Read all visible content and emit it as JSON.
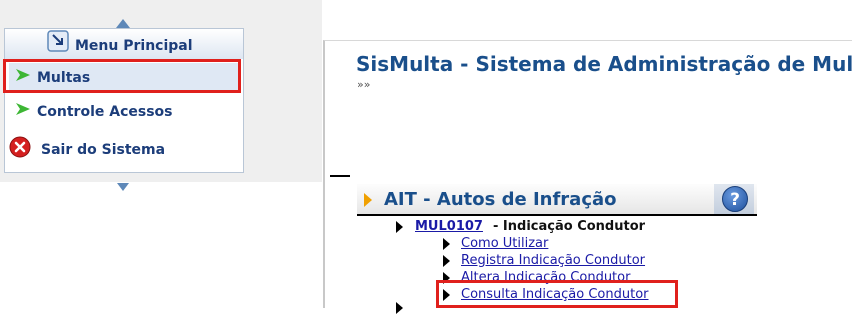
{
  "menu": {
    "title": "Menu Principal",
    "items": [
      {
        "label": "Multas",
        "icon": "green-arrow-icon",
        "selected": true
      },
      {
        "label": "Controle Acessos",
        "icon": "green-arrow-icon"
      },
      {
        "label": "Sair do Sistema",
        "icon": "red-x-circle-icon"
      }
    ]
  },
  "main": {
    "app_title": "SisMulta - Sistema de Administração de Multas",
    "breadcrumb": "»»",
    "section": {
      "title": "AIT - Autos de Infração",
      "help_label": "?"
    },
    "module": {
      "code": "MUL0107",
      "separator_name": " - Indicação Condutor",
      "links": [
        "Como Utilizar",
        "Registra Indicação Condutor",
        "Altera Indicação Condutor",
        "Consulta Indicação Condutor"
      ]
    }
  },
  "colors": {
    "highlight": "#e0201c",
    "title": "#1a4f8b",
    "link": "#1a1aa6",
    "menu_text": "#1c3d7a"
  }
}
